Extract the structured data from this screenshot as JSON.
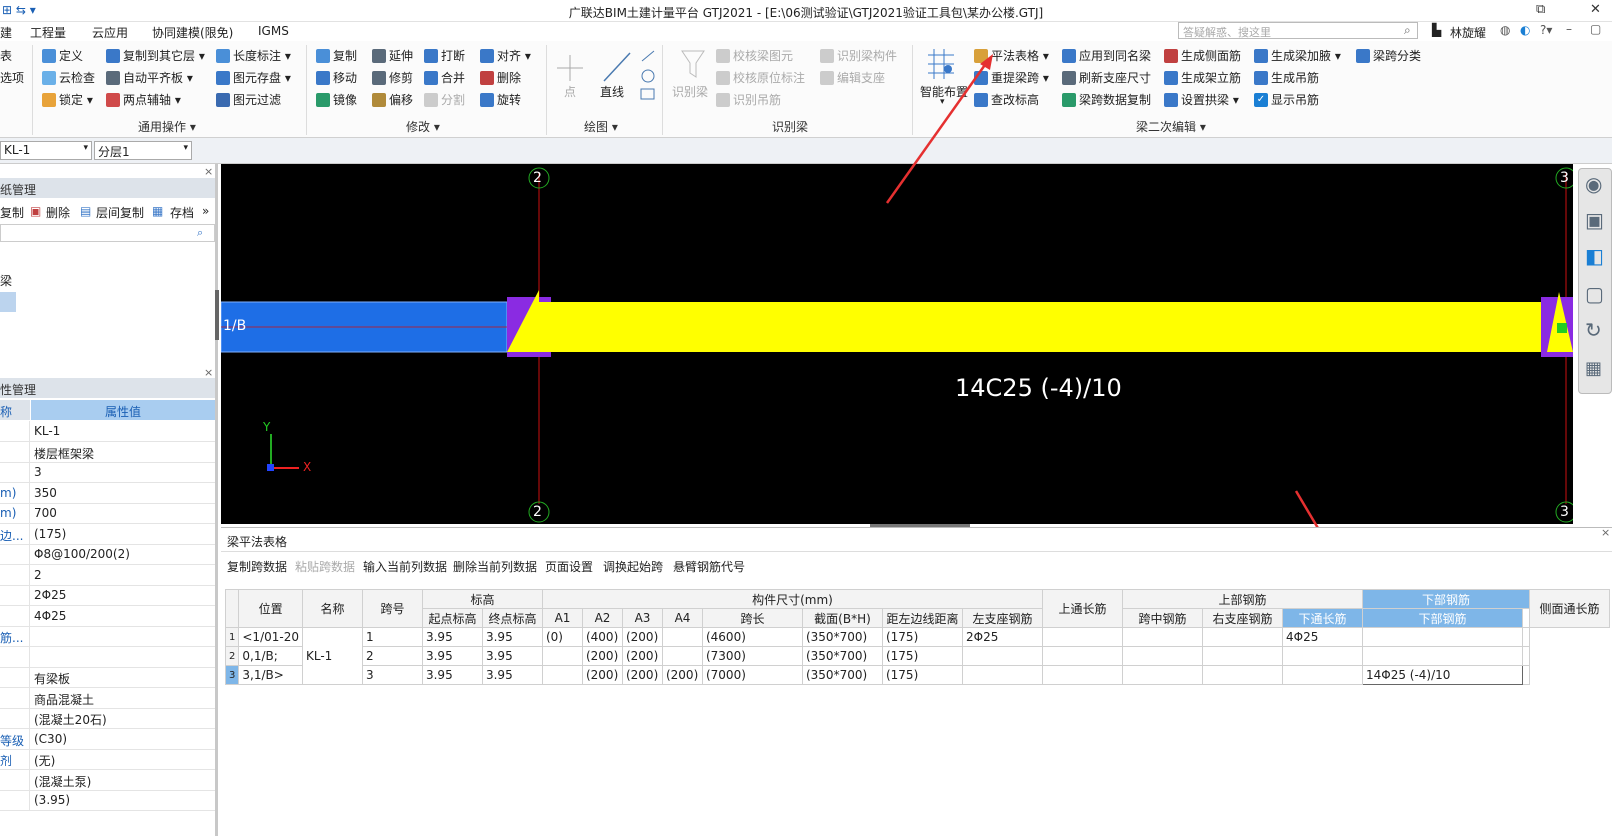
{
  "app": {
    "title": "广联达BIM土建计量平台 GTJ2021 - [E:\\06测试验证\\GTJ2021验证工具包\\某办公楼.GTJ]",
    "search_placeholder": "答疑解惑、搜这里",
    "user": "林旋耀"
  },
  "menu": [
    "建",
    "工程量",
    "云应用",
    "协同建模(限免)",
    "IGMS"
  ],
  "ribbon": {
    "left_cut": [
      "表",
      "选项"
    ],
    "general": {
      "items": [
        "定义",
        "云检查",
        "锁定",
        "复制到其它层",
        "自动平齐板",
        "两点辅轴",
        "长度标注",
        "图元存盘",
        "图元过滤"
      ],
      "label": "通用操作"
    },
    "modify": {
      "items": [
        "复制",
        "移动",
        "镜像",
        "延伸",
        "修剪",
        "偏移",
        "打断",
        "合并",
        "分割",
        "对齐",
        "删除",
        "旋转"
      ],
      "label": "修改"
    },
    "draw": {
      "items": [
        "点",
        "直线"
      ],
      "label": "绘图"
    },
    "identify": {
      "items": [
        "识别梁",
        "校核梁图元",
        "校核原位标注",
        "识别吊筋",
        "识别梁构件",
        "编辑支座"
      ],
      "label": "识别梁"
    },
    "secondary": {
      "items": [
        "智能布置",
        "平法表格",
        "重提梁跨",
        "查改标高",
        "应用到同名梁",
        "刷新支座尺寸",
        "梁跨数据复制",
        "生成侧面筋",
        "生成架立筋",
        "设置拱梁",
        "生成梁加腋",
        "生成吊筋",
        "显示吊筋",
        "梁跨分类"
      ],
      "label": "梁二次编辑"
    }
  },
  "selectors": {
    "element": "KL-1",
    "layer": "分层1"
  },
  "drawings_panel": {
    "title": "纸管理",
    "toolbar": [
      "复制",
      "删除",
      "层间复制",
      "存档"
    ],
    "tree": [
      "梁"
    ]
  },
  "props_panel": {
    "title": "性管理",
    "header": [
      "称",
      "属性值"
    ],
    "rows": [
      [
        "",
        "KL-1"
      ],
      [
        "",
        "楼层框架梁"
      ],
      [
        "",
        "3"
      ],
      [
        "m)",
        "350"
      ],
      [
        "m)",
        "700"
      ],
      [
        "边...",
        "(175)"
      ],
      [
        "",
        "Φ8@100/200(2)"
      ],
      [
        "",
        "2"
      ],
      [
        "",
        "2Φ25"
      ],
      [
        "",
        "4Φ25"
      ],
      [
        "筋...",
        ""
      ],
      [
        "",
        ""
      ],
      [
        "",
        "有梁板"
      ],
      [
        "",
        "商品混凝土"
      ],
      [
        "",
        "(混凝土20石)"
      ],
      [
        "等级",
        "(C30)"
      ],
      [
        "剂",
        "(无)"
      ],
      [
        "",
        "(混凝土泵)"
      ],
      [
        "",
        "(3.95)"
      ]
    ]
  },
  "viewport": {
    "axis_labels": [
      "2",
      "3",
      "2",
      "3"
    ],
    "beam_label": "1/B",
    "annotation": "14C25 (-4)/10",
    "coord_x": "X",
    "coord_y": "Y"
  },
  "table_panel": {
    "title": "梁平法表格",
    "toolbar": [
      "复制跨数据",
      "粘贴跨数据",
      "输入当前列数据",
      "删除当前列数据",
      "页面设置",
      "调换起始跨",
      "悬臂钢筋代号"
    ],
    "group_headers": [
      "标高",
      "构件尺寸(mm)",
      "上部钢筋",
      "下部钢筋"
    ],
    "columns": [
      "位置",
      "名称",
      "跨号",
      "起点标高",
      "终点标高",
      "A1",
      "A2",
      "A3",
      "A4",
      "跨长",
      "截面(B*H)",
      "距左边线距离",
      "上通长筋",
      "左支座钢筋",
      "跨中钢筋",
      "右支座钢筋",
      "下通长筋",
      "下部钢筋",
      "侧面通长筋"
    ],
    "rows": [
      [
        "1",
        "<1/01-20",
        "KL-1",
        "1",
        "3.95",
        "3.95",
        "(0)",
        "(400)",
        "(200)",
        "",
        "(4600)",
        "(350*700)",
        "(175)",
        "2Φ25",
        "",
        "",
        "",
        "4Φ25",
        "",
        ""
      ],
      [
        "2",
        "0,1/B;",
        "",
        "2",
        "3.95",
        "3.95",
        "",
        "(200)",
        "(200)",
        "",
        "(7300)",
        "(350*700)",
        "(175)",
        "",
        "",
        "",
        "",
        "",
        "",
        ""
      ],
      [
        "3",
        "3,1/B>",
        "",
        "3",
        "3.95",
        "3.95",
        "",
        "(200)",
        "(200)",
        "(200)",
        "(7000)",
        "(350*700)",
        "(175)",
        "",
        "",
        "",
        "",
        "",
        "14Φ25 (-4)/10",
        ""
      ]
    ]
  },
  "colors": {
    "beam_yellow": "#ffff00",
    "beam_blue": "#1e6ee6",
    "support_purple": "#8a2be2",
    "axis_red": "#cc1111",
    "arrow_red": "#e53030",
    "axis_green": "#22aa22"
  }
}
